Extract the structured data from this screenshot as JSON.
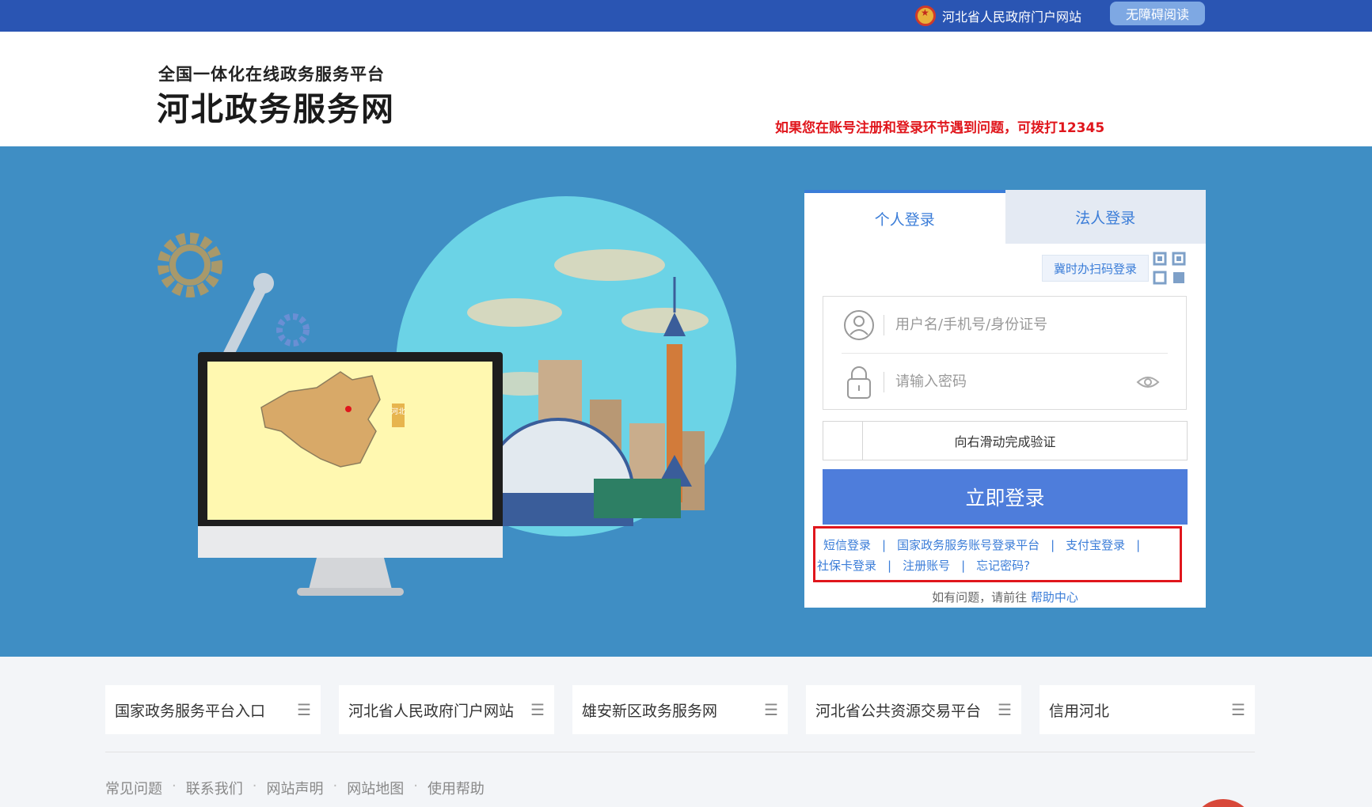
{
  "topbar": {
    "gov_site": "河北省人民政府门户网站",
    "accessible_reading": "无障碍阅读"
  },
  "header": {
    "subtitle": "全国一体化在线政务服务平台",
    "title": "河北政务服务网",
    "notice": "如果您在账号注册和登录环节遇到问题，可拨打12345"
  },
  "login": {
    "tabs": [
      {
        "label": "个人登录",
        "active": true
      },
      {
        "label": "法人登录",
        "active": false
      }
    ],
    "qr_login": "冀时办扫码登录",
    "username_placeholder": "用户名/手机号/身份证号",
    "password_placeholder": "请输入密码",
    "slider_text": "向右滑动完成验证",
    "submit": "立即登录",
    "links_row1": [
      "短信登录",
      "国家政务服务账号登录平台",
      "支付宝登录"
    ],
    "links_row2": [
      "社保卡登录",
      "注册账号",
      "忘记密码?"
    ],
    "help_text": "如有问题，请前往",
    "help_link": "帮助中心"
  },
  "illustration": {
    "map_label": "河北"
  },
  "quick_links": [
    "国家政务服务平台入口",
    "河北省人民政府门户网站",
    "雄安新区政务服务网",
    "河北省公共资源交易平台",
    "信用河北"
  ],
  "footer_links": [
    "常见问题",
    "联系我们",
    "网站声明",
    "网站地图",
    "使用帮助"
  ],
  "colors": {
    "topbar": "#2a55b3",
    "hero": "#3f8ec4",
    "accent": "#3b7dd8",
    "button": "#4e7ddb",
    "notice_red": "#e0161c"
  }
}
